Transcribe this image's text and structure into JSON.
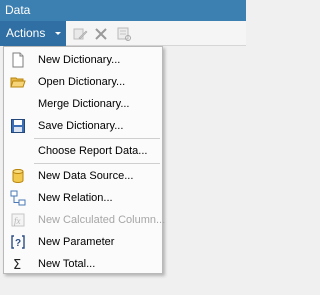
{
  "panel": {
    "title": "Data"
  },
  "toolbar": {
    "actions_label": "Actions",
    "icons": [
      "edit-icon",
      "delete-icon",
      "properties-icon"
    ]
  },
  "menu": {
    "items": [
      {
        "label": "New Dictionary...",
        "icon": "new-document-icon",
        "enabled": true
      },
      {
        "label": "Open Dictionary...",
        "icon": "open-folder-icon",
        "enabled": true
      },
      {
        "label": "Merge Dictionary...",
        "icon": "",
        "enabled": true
      },
      {
        "label": "Save Dictionary...",
        "icon": "save-disk-icon",
        "enabled": true
      },
      {
        "label": "Choose Report Data...",
        "icon": "",
        "enabled": true
      },
      {
        "label": "New Data Source...",
        "icon": "database-icon",
        "enabled": true
      },
      {
        "label": "New Relation...",
        "icon": "relation-icon",
        "enabled": true
      },
      {
        "label": "New Calculated Column...",
        "icon": "calculated-column-icon",
        "enabled": false
      },
      {
        "label": "New Parameter",
        "icon": "parameter-icon",
        "enabled": true
      },
      {
        "label": "New Total...",
        "icon": "sigma-total-icon",
        "enabled": true
      }
    ]
  },
  "colors": {
    "title_bar": "#3c7fb1",
    "actions_button": "#2f6fa3",
    "menu_background": "#fbfbfb",
    "disabled_text": "#a6a6a6"
  }
}
